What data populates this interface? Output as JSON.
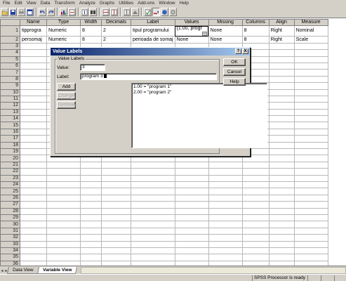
{
  "menu": [
    "File",
    "Edit",
    "View",
    "Data",
    "Transform",
    "Analyze",
    "Graphs",
    "Utilities",
    "Add-ons",
    "Window",
    "Help"
  ],
  "toolbar": {
    "buttons": [
      "open-icon",
      "save-icon",
      "print-icon",
      "dialog-recall-icon",
      "undo-icon",
      "redo-icon",
      "goto-chart-icon",
      "goto-case-icon",
      "variables-icon",
      "find-icon",
      "insert-cases-icon",
      "insert-variable-icon",
      "split-file-icon",
      "weight-cases-icon",
      "select-cases-icon",
      "value-labels-icon",
      "use-sets-icon",
      "show-all-variables-icon"
    ]
  },
  "columns": [
    "Name",
    "Type",
    "Width",
    "Decimals",
    "Label",
    "Values",
    "Missing",
    "Columns",
    "Align",
    "Measure"
  ],
  "rows": [
    [
      "tipprogra",
      "Numeric",
      "8",
      "2",
      "tipul programului",
      "{1.00, progr",
      "None",
      "8",
      "Right",
      "Nominal"
    ],
    [
      "persomaj",
      "Numeric",
      "8",
      "2",
      "perioada de somaj",
      "None",
      "None",
      "8",
      "Right",
      "Scale"
    ]
  ],
  "row_numbers": [
    "1",
    "2",
    "3",
    "4",
    "5",
    "6",
    "7",
    "8",
    "9",
    "10",
    "11",
    "12",
    "13",
    "14",
    "15",
    "16",
    "17",
    "18",
    "19",
    "20",
    "21",
    "22",
    "23",
    "24",
    "25",
    "26",
    "27",
    "28",
    "29",
    "30",
    "31",
    "32",
    "33",
    "34",
    "35",
    "36"
  ],
  "tabs": {
    "data_view": "Data View",
    "variable_view": "Variable View"
  },
  "status": {
    "processor": "SPSS Processor  is ready"
  },
  "dialog": {
    "title": "Value Labels",
    "help_glyph": "?",
    "close_glyph": "X",
    "group_title": "Value Labels",
    "value_label": "Value:",
    "value": "3",
    "label_label": "Label:",
    "label_value": "program 3",
    "add": "Add",
    "change": "Change",
    "remove": "Remove",
    "ok": "OK",
    "cancel": "Cancel",
    "help": "Help",
    "list": [
      "1.00 = \"program 1\"",
      "2.00 = \"program 2\""
    ]
  }
}
